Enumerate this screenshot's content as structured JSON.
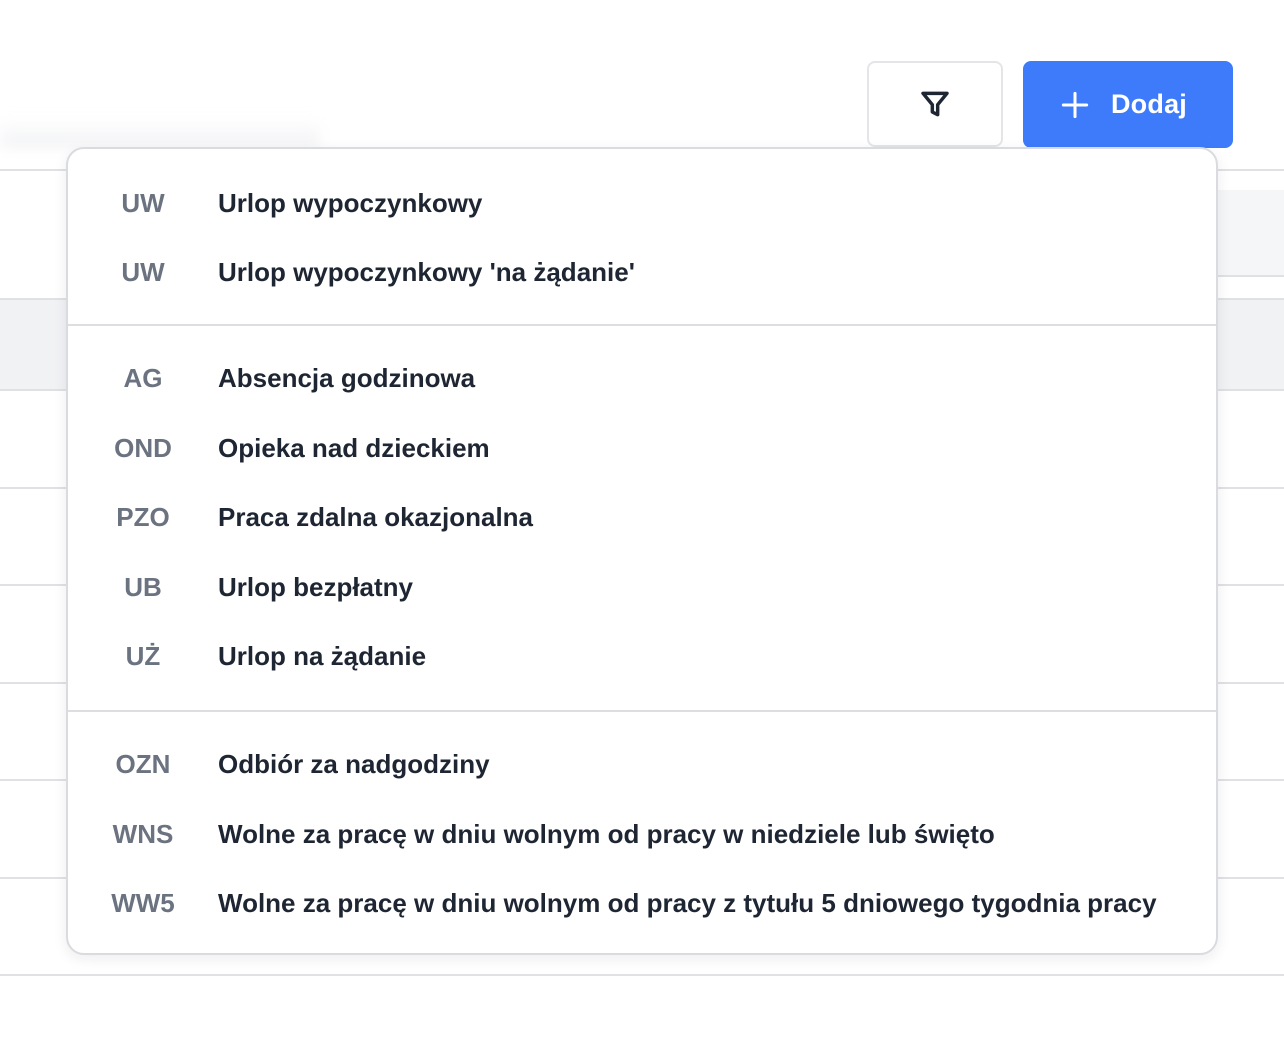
{
  "toolbar": {
    "filter_icon": "filter-icon",
    "add_icon": "plus-icon",
    "add_label": "Dodaj",
    "accent_color": "#3d7bfa"
  },
  "menu": {
    "groups": [
      {
        "items": [
          {
            "code": "UW",
            "label": "Urlop wypoczynkowy"
          },
          {
            "code": "UW",
            "label": "Urlop wypoczynkowy 'na żądanie'"
          }
        ]
      },
      {
        "items": [
          {
            "code": "AG",
            "label": "Absencja godzinowa"
          },
          {
            "code": "OND",
            "label": "Opieka nad dzieckiem"
          },
          {
            "code": "PZO",
            "label": "Praca zdalna okazjonalna"
          },
          {
            "code": "UB",
            "label": "Urlop bezpłatny"
          },
          {
            "code": "UŻ",
            "label": "Urlop na żądanie"
          }
        ]
      },
      {
        "items": [
          {
            "code": "OZN",
            "label": "Odbiór za nadgodziny"
          },
          {
            "code": "WNS",
            "label": "Wolne za pracę w dniu wolnym od pracy w niedziele lub święto"
          },
          {
            "code": "WW5",
            "label": "Wolne za pracę w dniu wolnym od pracy z tytułu 5 dniowego tygodnia pracy"
          }
        ]
      }
    ]
  }
}
